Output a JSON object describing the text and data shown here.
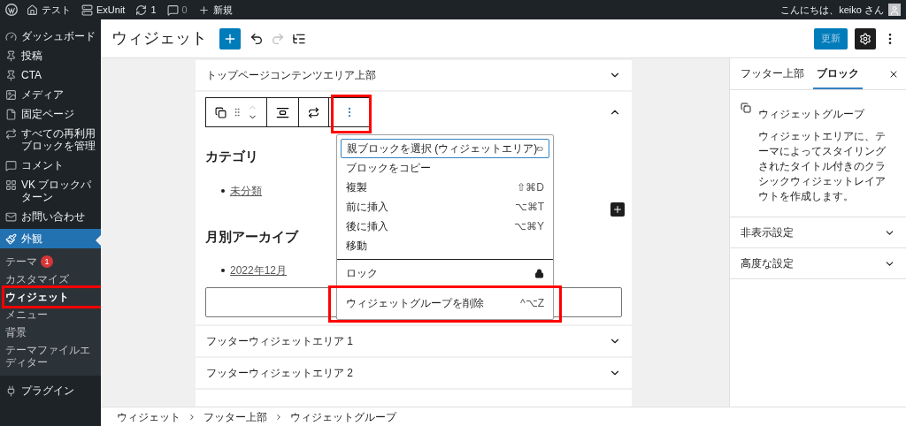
{
  "admin_bar": {
    "items": [
      {
        "label": "テスト"
      },
      {
        "label": "ExUnit"
      },
      {
        "label": "1"
      },
      {
        "label": "0"
      },
      {
        "label": "新規"
      }
    ],
    "greeting": "こんにちは、keiko さん"
  },
  "sidebar": {
    "items": [
      {
        "label": "ダッシュボード",
        "selected": false
      },
      {
        "label": "投稿",
        "selected": false
      },
      {
        "label": "CTA",
        "selected": false
      },
      {
        "label": "メディア",
        "selected": false
      },
      {
        "label": "固定ページ",
        "selected": false
      },
      {
        "label": "すべての再利用ブロックを管理",
        "selected": false
      },
      {
        "label": "コメント",
        "selected": false
      },
      {
        "label": "VK ブロックパターン",
        "selected": false
      },
      {
        "label": "お問い合わせ",
        "selected": false
      },
      {
        "label": "外観",
        "selected": true,
        "children": [
          {
            "label": "テーマ",
            "badge": "1",
            "selected": false,
            "highlighted": false
          },
          {
            "label": "カスタマイズ",
            "selected": false,
            "highlighted": false
          },
          {
            "label": "ウィジェット",
            "selected": true,
            "highlighted": true
          },
          {
            "label": "メニュー",
            "selected": false,
            "highlighted": false
          },
          {
            "label": "背景",
            "selected": false,
            "highlighted": false
          },
          {
            "label": "テーマファイルエディター",
            "selected": false,
            "highlighted": false
          }
        ]
      },
      {
        "label": "プラグイン",
        "selected": false
      }
    ]
  },
  "header": {
    "title": "ウィジェット",
    "update_button": "更新",
    "settings_on": true
  },
  "editor": {
    "areas": [
      {
        "title": "トップページコンテンツエリア上部",
        "expanded": false
      },
      {
        "expanded": true,
        "toolbar": {
          "more_highlighted": true
        },
        "widgets": [
          {
            "heading": "カテゴリ",
            "links": [
              "未分類"
            ]
          },
          {
            "heading": "月別アーカイブ",
            "links": [
              "2022年12月"
            ]
          }
        ]
      },
      {
        "title": "フッターウィジェットエリア 1",
        "expanded": false
      },
      {
        "title": "フッターウィジェットエリア 2",
        "expanded": false
      }
    ]
  },
  "menu": {
    "groups": [
      [
        {
          "label": "親ブロックを選択 (ウィジェットエリア)",
          "kind": "parent",
          "focused": true,
          "highlighted": false
        },
        {
          "label": "ブロックをコピー",
          "kind": "plain",
          "focused": false,
          "highlighted": false
        },
        {
          "label": "複製",
          "shortcut": "⇧⌘D",
          "kind": "plain",
          "focused": false,
          "highlighted": false
        },
        {
          "label": "前に挿入",
          "shortcut": "⌥⌘T",
          "kind": "plain",
          "focused": false,
          "highlighted": false
        },
        {
          "label": "後に挿入",
          "shortcut": "⌥⌘Y",
          "kind": "plain",
          "focused": false,
          "highlighted": false
        },
        {
          "label": "移動",
          "kind": "plain",
          "focused": false,
          "highlighted": false
        }
      ],
      [
        {
          "label": "ロック",
          "kind": "lock",
          "focused": false,
          "highlighted": false
        }
      ],
      [
        {
          "label": "ウィジェットグループを削除",
          "shortcut": "^⌥Z",
          "kind": "plain",
          "focused": false,
          "highlighted": true
        }
      ]
    ]
  },
  "panel": {
    "tabs": [
      {
        "label": "フッター上部",
        "selected": false
      },
      {
        "label": "ブロック",
        "selected": true
      }
    ],
    "block_name": "ウィジェットグループ",
    "description": "ウィジェットエリアに、テーマによってスタイリングされたタイトル付きのクラシックウィジェットレイアウトを作成します。",
    "sections": [
      {
        "label": "非表示設定",
        "expanded": false
      },
      {
        "label": "高度な設定",
        "expanded": false
      }
    ]
  },
  "breadcrumb": [
    "ウィジェット",
    "フッター上部",
    "ウィジェットグループ"
  ]
}
